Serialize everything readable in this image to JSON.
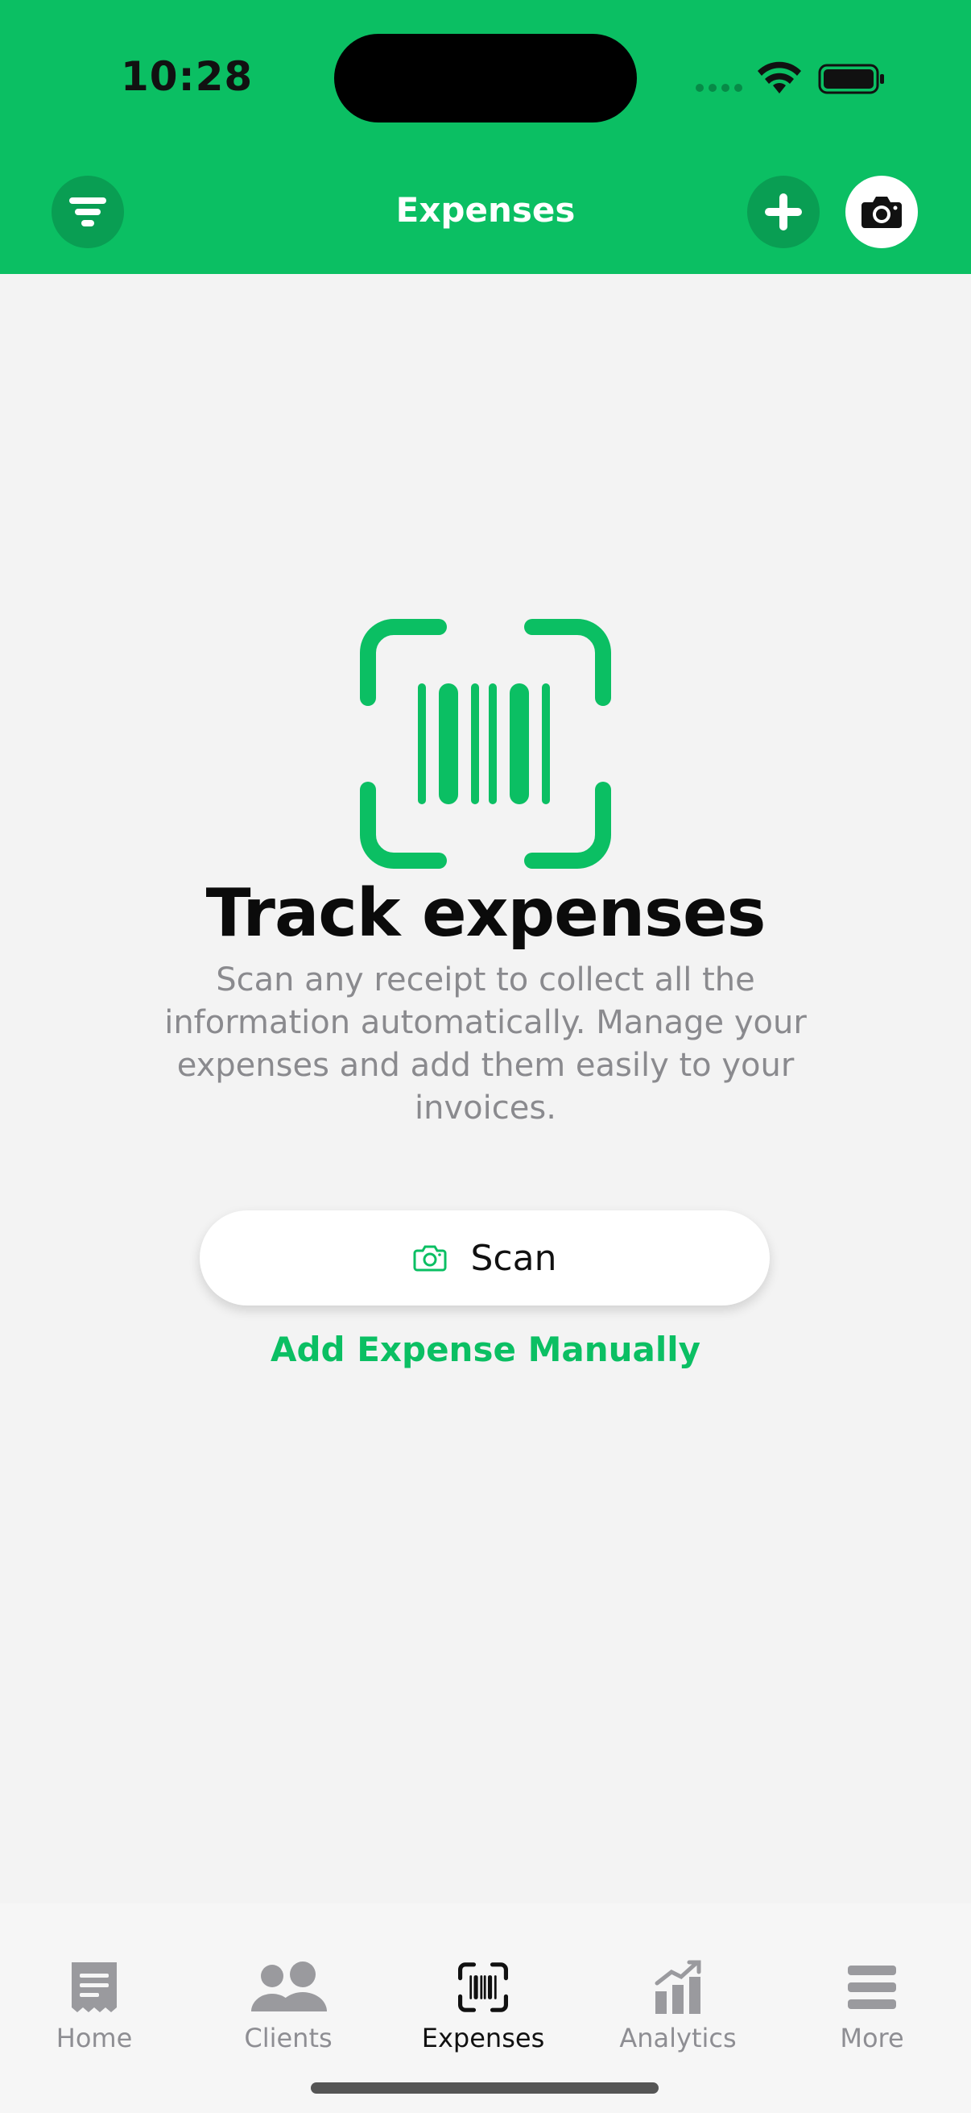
{
  "status_bar": {
    "time": "10:28"
  },
  "header": {
    "title": "Expenses",
    "background": "#0bbf63",
    "left_icon": "filter-icon",
    "right_icons": [
      "plus-icon",
      "camera-icon"
    ]
  },
  "empty_state": {
    "icon": "barcode-scan-icon",
    "title": "Track expenses",
    "description": "Scan any receipt to collect all the information automatically. Manage your expenses and add them easily to your invoices.",
    "scan_button_label": "Scan",
    "manual_link_label": "Add Expense Manually"
  },
  "tabs": [
    {
      "label": "Home",
      "icon": "receipt-icon",
      "active": false
    },
    {
      "label": "Clients",
      "icon": "people-icon",
      "active": false
    },
    {
      "label": "Expenses",
      "icon": "barcode-scan-icon",
      "active": true
    },
    {
      "label": "Analytics",
      "icon": "chart-icon",
      "active": false
    },
    {
      "label": "More",
      "icon": "menu-icon",
      "active": false
    }
  ],
  "colors": {
    "accent": "#0bbf63",
    "accent_dark": "#099e53",
    "background": "#f3f3f3"
  }
}
